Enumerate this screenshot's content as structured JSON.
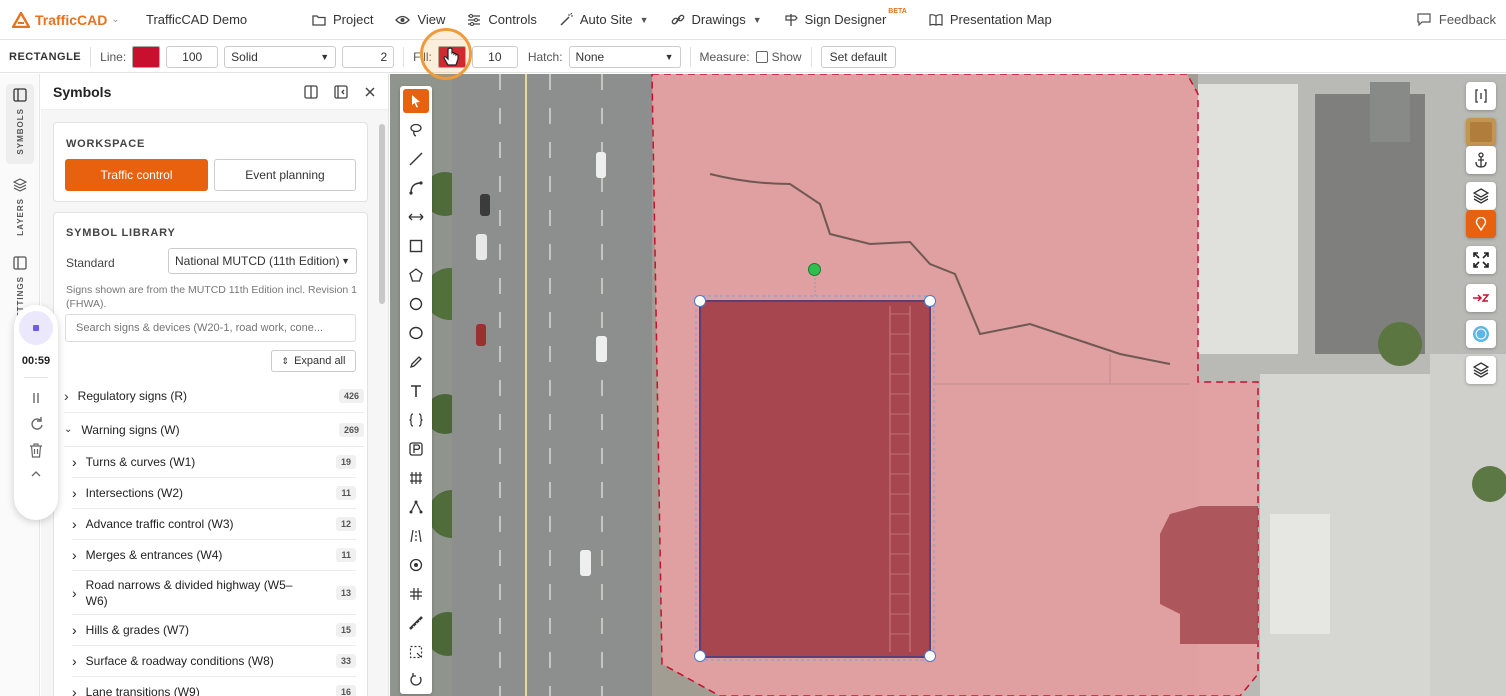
{
  "topbar": {
    "brand": "TrafficCAD",
    "project_name": "TrafficCAD Demo",
    "menu": {
      "project": "Project",
      "view": "View",
      "controls": "Controls",
      "auto_site": "Auto Site",
      "drawings": "Drawings",
      "sign_designer": "Sign Designer",
      "sign_designer_badge": "BETA",
      "presentation_map": "Presentation Map"
    },
    "feedback": "Feedback"
  },
  "toolbar": {
    "shape_label": "RECTANGLE",
    "line_label": "Line:",
    "line_color": "#c8102e",
    "line_width": "100",
    "line_style": "Solid",
    "line_weight": "2",
    "fill_label": "Fill:",
    "fill_color": "#c8102e",
    "fill_opacity": "10",
    "hatch_label": "Hatch:",
    "hatch_value": "None",
    "measure_label": "Measure:",
    "show_label": "Show",
    "set_default": "Set default"
  },
  "rail": {
    "symbols": "SYMBOLS",
    "layers": "LAYERS",
    "settings": "SETTINGS"
  },
  "recorder": {
    "time": "00:59"
  },
  "panel": {
    "title": "Symbols",
    "workspace_title": "WORKSPACE",
    "workspace_options": [
      "Traffic control",
      "Event planning"
    ],
    "library_title": "SYMBOL LIBRARY",
    "standard_label": "Standard",
    "standard_value": "National MUTCD (11th Edition)",
    "note": "Signs shown are from the MUTCD 11th Edition incl. Revision 1 (FHWA).",
    "search_placeholder": "Search signs & devices (W20-1, road work, cone...",
    "expand_all": "Expand all",
    "categories": [
      {
        "label": "Regulatory signs (R)",
        "count": "426"
      },
      {
        "label": "Warning signs (W)",
        "count": "269"
      }
    ],
    "subcategories": [
      {
        "label": "Turns & curves (W1)",
        "count": "19"
      },
      {
        "label": "Intersections (W2)",
        "count": "11"
      },
      {
        "label": "Advance traffic control (W3)",
        "count": "12"
      },
      {
        "label": "Merges & entrances (W4)",
        "count": "11"
      },
      {
        "label": "Road narrows & divided highway (W5–W6)",
        "count": "13"
      },
      {
        "label": "Hills & grades (W7)",
        "count": "15"
      },
      {
        "label": "Surface & roadway conditions (W8)",
        "count": "33"
      },
      {
        "label": "Lane transitions (W9)",
        "count": "16"
      }
    ]
  },
  "colors": {
    "accent": "#e8610f",
    "brand": "#e8731e",
    "shape_red": "#c8102e"
  }
}
